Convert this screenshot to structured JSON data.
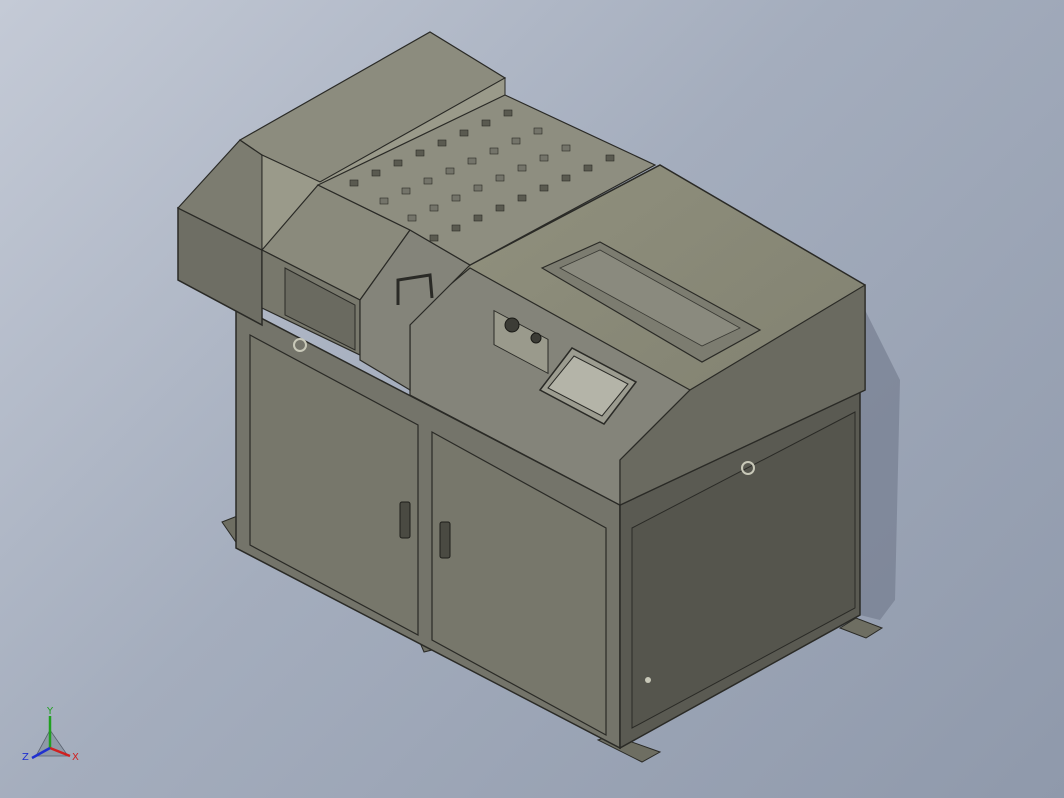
{
  "viewport": {
    "background_top": "#c4cad6",
    "background_bottom": "#8f99ab"
  },
  "model": {
    "body_color": "#7a7a6a",
    "panel_color": "#868676",
    "top_color": "#8a8a7a",
    "dark_panel_color": "#5e5e54",
    "edge_color": "#2a2a26",
    "icons": [
      "door-handle-icon",
      "knob-icon",
      "touchscreen-icon",
      "pull-handle-icon",
      "ring-pull-icon"
    ]
  },
  "triad": {
    "x_label": "X",
    "y_label": "Y",
    "z_label": "Z",
    "x_color": "#d02020",
    "y_color": "#20a020",
    "z_color": "#2030d0"
  }
}
